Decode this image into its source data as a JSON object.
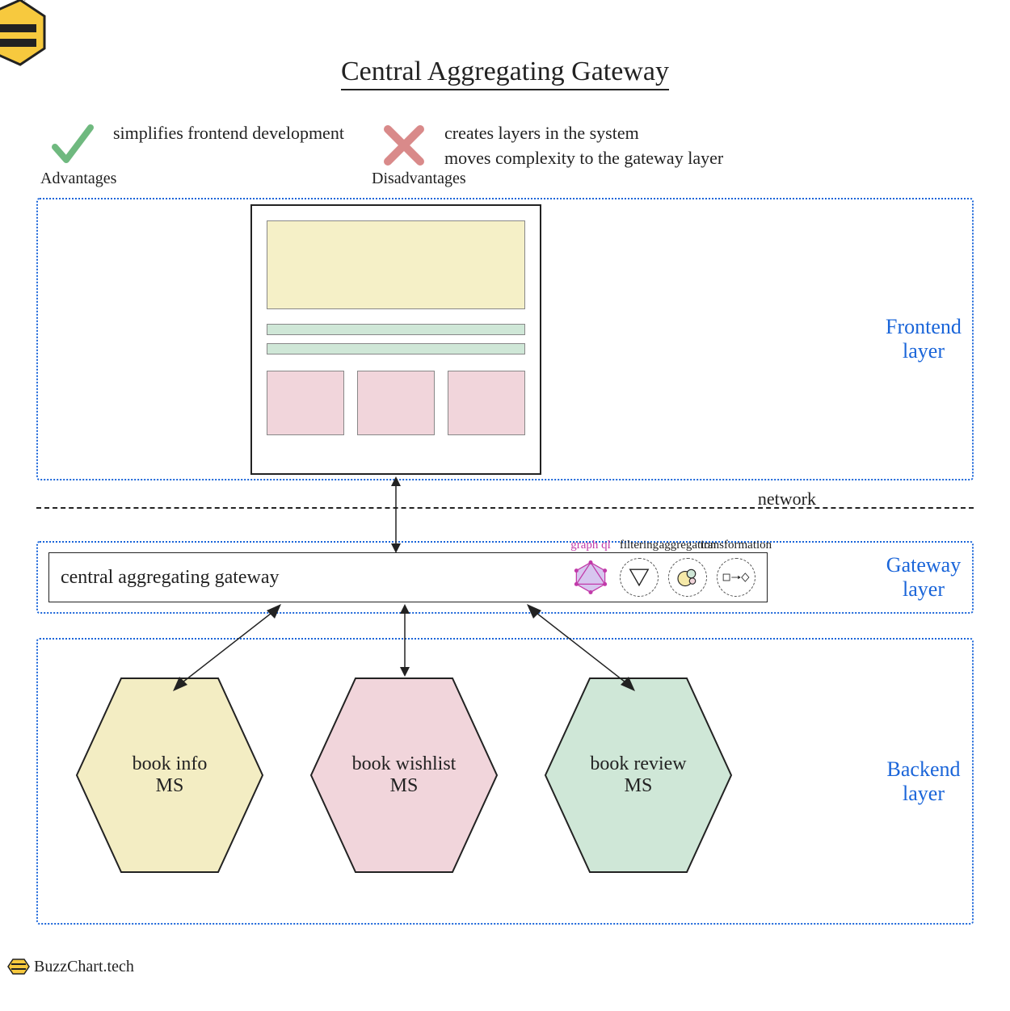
{
  "title": "Central Aggregating Gateway",
  "advantages": {
    "label": "Advantages",
    "items": [
      "simplifies frontend development"
    ]
  },
  "disadvantages": {
    "label": "Disadvantages",
    "items": [
      "creates layers in the system",
      "moves complexity to the gateway layer"
    ]
  },
  "layers": {
    "frontend": "Frontend\nlayer",
    "gateway": "Gateway\nlayer",
    "backend": "Backend\nlayer"
  },
  "network_label": "network",
  "gateway": {
    "name": "central aggregating gateway",
    "capabilities": [
      {
        "id": "graphql",
        "label": "graph ql"
      },
      {
        "id": "filtering",
        "label": "filtering"
      },
      {
        "id": "aggregation",
        "label": "aggregation"
      },
      {
        "id": "transformation",
        "label": "transformation"
      }
    ]
  },
  "microservices": [
    {
      "name": "book info\nMS",
      "color": "#f3edc3"
    },
    {
      "name": "book wishlist\nMS",
      "color": "#f1d5db"
    },
    {
      "name": "book review\nMS",
      "color": "#cfe7d7"
    }
  ],
  "footer": "BuzzChart.tech",
  "colors": {
    "blue": "#1a65d9",
    "yellow": "#f3edc3",
    "pink": "#f1d5db",
    "green": "#cfe7d7",
    "magenta": "#c23aa9"
  }
}
